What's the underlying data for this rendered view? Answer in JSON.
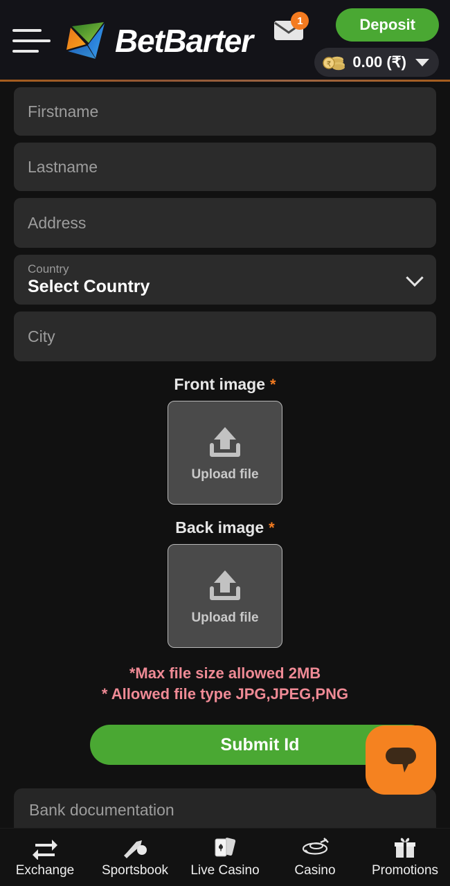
{
  "header": {
    "menu_icon": "hamburger-menu-icon",
    "brand_name": "BetBarter",
    "brand_logo_icon": "betbarter-triangle-logo",
    "mail_icon": "envelope-icon",
    "mail_badge_count": "1",
    "deposit_label": "Deposit",
    "balance_icon": "coins-icon",
    "balance_value": "0.00 (₹)",
    "balance_caret_icon": "caret-down-icon"
  },
  "form": {
    "firstname_placeholder": "Firstname",
    "lastname_placeholder": "Lastname",
    "address_placeholder": "Address",
    "country_label": "Country",
    "country_value": "Select Country",
    "country_chevron_icon": "chevron-down-icon",
    "city_placeholder": "City"
  },
  "uploads": {
    "front": {
      "title": "Front image",
      "required_marker": "*",
      "button_text": "Upload file",
      "icon": "upload-tray-icon"
    },
    "back": {
      "title": "Back image",
      "required_marker": "*",
      "button_text": "Upload file",
      "icon": "upload-tray-icon"
    },
    "notes": [
      "*Max file size allowed 2MB",
      "* Allowed file type JPG,JPEG,PNG"
    ]
  },
  "actions": {
    "submit_label": "Submit Id",
    "chat_icon": "chat-bubble-icon"
  },
  "bank_section": {
    "title": "Bank documentation"
  },
  "bottom_nav": [
    {
      "label": "Exchange",
      "icon": "exchange-arrows-icon"
    },
    {
      "label": "Sportsbook",
      "icon": "cricket-bat-ball-icon"
    },
    {
      "label": "Live Casino",
      "icon": "playing-cards-icon"
    },
    {
      "label": "Casino",
      "icon": "roulette-table-icon"
    },
    {
      "label": "Promotions",
      "icon": "gift-box-icon"
    }
  ],
  "colors": {
    "background": "#111111",
    "header_bg": "#131318",
    "field_bg": "#2b2b2b",
    "accent_green": "#4aa833",
    "accent_orange": "#f58220",
    "note_pink": "#ef8a95",
    "upload_box": "#4a4a4a"
  }
}
